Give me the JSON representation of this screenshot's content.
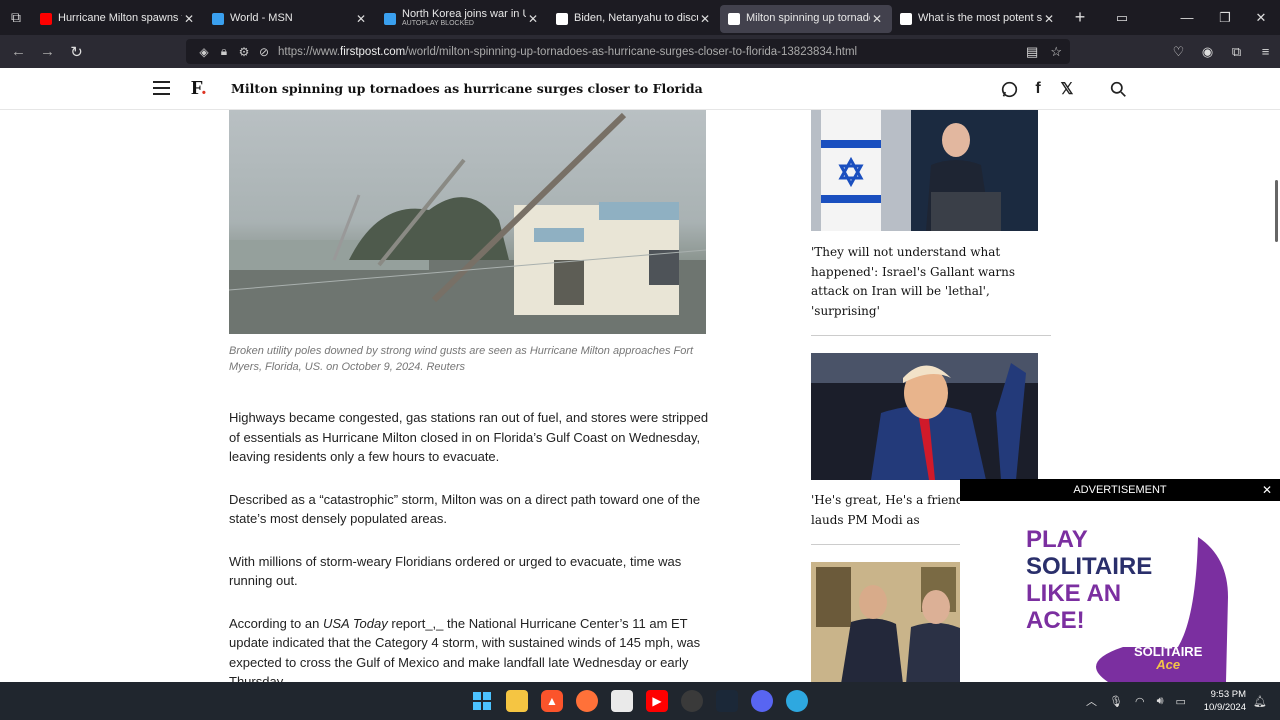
{
  "browser": {
    "tabs": [
      {
        "title": "Hurricane Milton spawns torn",
        "sub": "",
        "favicon": "youtube-icon",
        "color": "#ff0000",
        "active": false
      },
      {
        "title": "World - MSN",
        "sub": "",
        "favicon": "msn-icon",
        "color": "#3aa0ef",
        "active": false
      },
      {
        "title": "North Korea joins war in Ukrai",
        "sub": "AUTOPLAY BLOCKED",
        "favicon": "msn-icon",
        "color": "#3aa0ef",
        "active": false
      },
      {
        "title": "Biden, Netanyahu to discuss t",
        "sub": "",
        "favicon": "firstpost-icon",
        "color": "#ffffff",
        "active": false
      },
      {
        "title": "Milton spinning up tornadoes",
        "sub": "",
        "favicon": "firstpost-icon",
        "color": "#ffffff",
        "active": true
      },
      {
        "title": "What is the most potent sourc",
        "sub": "",
        "favicon": "chatgpt-icon",
        "color": "#ffffff",
        "active": false
      }
    ],
    "url_prefix": "https://www.",
    "url_domain": "firstpost.com",
    "url_path": "/world/milton-spinning-up-tornadoes-as-hurricane-surges-closer-to-florida-13823834.html"
  },
  "site": {
    "logo": "F",
    "headline": "Milton spinning up tornadoes as hurricane surges closer to Florida"
  },
  "article": {
    "caption": "Broken utility poles downed by strong wind gusts are seen as Hurricane Milton approaches Fort Myers, Florida, US. on October 9, 2024. Reuters",
    "p1": "Highways became congested, gas stations ran out of fuel, and stores were stripped of essentials as Hurricane Milton closed in on Florida’s Gulf Coast on Wednesday, leaving residents only a few hours to evacuate.",
    "p2": "Described as a “catastrophic” storm, Milton was on a direct path toward one of the state’s most densely populated areas.",
    "p3": "With millions of storm-weary Floridians ordered or urged to evacuate, time was running out.",
    "p4_a": "According to an ",
    "p4_em": "USA Today",
    "p4_b": " report_,_ the National Hurricane Center’s 11 am ET update indicated that the Category 4 storm, with sustained winds of 145 mph, was expected to cross the Gulf of Mexico and make landfall late Wednesday or early Thursday."
  },
  "sidebar": {
    "story1": "'They will not understand what happened': Israel's Gallant warns attack on Iran will be 'lethal', 'surprising'",
    "story2": "'He's great, He's a friend of Trump lauds PM Modi as"
  },
  "ad": {
    "header": "ADVERTISEMENT",
    "close": "✕",
    "line1": "PLAY",
    "line2": "SOLITAIRE",
    "line3": "LIKE AN",
    "line4": "ACE!",
    "brand": "SOLITAIRE",
    "brand2": "Ace"
  },
  "taskbar": {
    "time": "9:53 PM",
    "date": "10/9/2024"
  }
}
